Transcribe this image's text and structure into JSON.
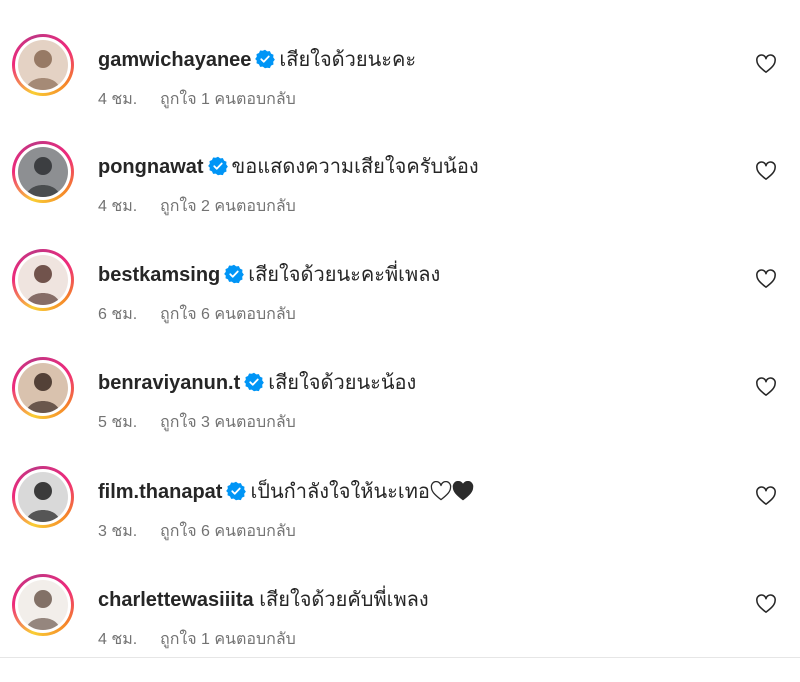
{
  "comments": [
    {
      "username": "gamwichayanee",
      "verified": true,
      "text": "เสียใจด้วยนะคะ",
      "time": "4 ชม.",
      "likes": "ถูกใจ 1 คน",
      "reply": "ตอบกลับ",
      "avatar_bg": "#e4d2c4",
      "avatar_fg": "#8a6b55"
    },
    {
      "username": "pongnawat",
      "verified": true,
      "text": "ขอแสดงความเสียใจครับน้อง",
      "time": "4 ชม.",
      "likes": "ถูกใจ 2 คน",
      "reply": "ตอบกลับ",
      "avatar_bg": "#8d8f92",
      "avatar_fg": "#2e3033"
    },
    {
      "username": "bestkamsing",
      "verified": true,
      "text": "เสียใจด้วยนะคะพี่เพลง",
      "time": "6 ชม.",
      "likes": "ถูกใจ 6 คน",
      "reply": "ตอบกลับ",
      "avatar_bg": "#efe4df",
      "avatar_fg": "#5a3a33"
    },
    {
      "username": "benraviyanun.t",
      "verified": true,
      "text": "เสียใจด้วยนะน้อง",
      "time": "5 ชม.",
      "likes": "ถูกใจ 3 คน",
      "reply": "ตอบกลับ",
      "avatar_bg": "#d9c2ae",
      "avatar_fg": "#3b2a22"
    },
    {
      "username": "film.thanapat",
      "verified": true,
      "text": "เป็นกำลังใจให้นะเทอ",
      "time": "3 ชม.",
      "likes": "ถูกใจ 6 คน",
      "reply": "ตอบกลับ",
      "avatar_bg": "#d9d9d9",
      "avatar_fg": "#1e1e1e",
      "emojis": [
        "white-heart-icon",
        "black-heart-icon"
      ]
    },
    {
      "username": "charlettewasiiita",
      "verified": false,
      "text": "เสียใจด้วยคับพี่เพลง",
      "time": "4 ชม.",
      "likes": "ถูกใจ 1 คน",
      "reply": "ตอบกลับ",
      "avatar_bg": "#f2eeea",
      "avatar_fg": "#6e5a50"
    }
  ],
  "colors": {
    "verified": "#0095f6",
    "meta": "#737373",
    "text": "#262626"
  }
}
